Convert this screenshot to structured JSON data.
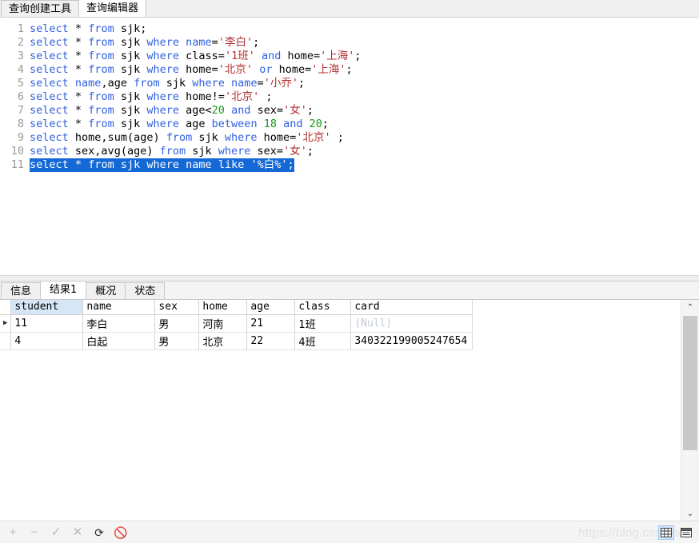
{
  "top_tabs": [
    {
      "label": "查询创建工具",
      "active": false
    },
    {
      "label": "查询编辑器",
      "active": true
    }
  ],
  "editor": {
    "line_numbers": [
      "1",
      "2",
      "3",
      "4",
      "5",
      "6",
      "7",
      "8",
      "9",
      "10",
      "11"
    ],
    "lines": [
      {
        "n": "1",
        "selected": false,
        "tokens": [
          {
            "t": "select",
            "c": "kw"
          },
          {
            "t": " ",
            "c": "plain"
          },
          {
            "t": "*",
            "c": "plain"
          },
          {
            "t": " ",
            "c": "plain"
          },
          {
            "t": "from",
            "c": "kw"
          },
          {
            "t": " ",
            "c": "plain"
          },
          {
            "t": "sjk;",
            "c": "plain"
          }
        ]
      },
      {
        "n": "2",
        "selected": false,
        "tokens": [
          {
            "t": "select",
            "c": "kw"
          },
          {
            "t": " ",
            "c": "plain"
          },
          {
            "t": "*",
            "c": "plain"
          },
          {
            "t": " ",
            "c": "plain"
          },
          {
            "t": "from",
            "c": "kw"
          },
          {
            "t": " ",
            "c": "plain"
          },
          {
            "t": "sjk ",
            "c": "plain"
          },
          {
            "t": "where",
            "c": "kw"
          },
          {
            "t": " ",
            "c": "plain"
          },
          {
            "t": "name",
            "c": "kw"
          },
          {
            "t": "=",
            "c": "plain"
          },
          {
            "t": "'李白'",
            "c": "str"
          },
          {
            "t": ";",
            "c": "plain"
          }
        ]
      },
      {
        "n": "3",
        "selected": false,
        "tokens": [
          {
            "t": "select",
            "c": "kw"
          },
          {
            "t": " ",
            "c": "plain"
          },
          {
            "t": "*",
            "c": "plain"
          },
          {
            "t": " ",
            "c": "plain"
          },
          {
            "t": "from",
            "c": "kw"
          },
          {
            "t": " ",
            "c": "plain"
          },
          {
            "t": "sjk ",
            "c": "plain"
          },
          {
            "t": "where",
            "c": "kw"
          },
          {
            "t": " ",
            "c": "plain"
          },
          {
            "t": "class=",
            "c": "plain"
          },
          {
            "t": "'1班'",
            "c": "str"
          },
          {
            "t": " ",
            "c": "plain"
          },
          {
            "t": "and",
            "c": "kw"
          },
          {
            "t": " ",
            "c": "plain"
          },
          {
            "t": "home=",
            "c": "plain"
          },
          {
            "t": "'上海'",
            "c": "str"
          },
          {
            "t": ";",
            "c": "plain"
          }
        ]
      },
      {
        "n": "4",
        "selected": false,
        "tokens": [
          {
            "t": "select",
            "c": "kw"
          },
          {
            "t": " ",
            "c": "plain"
          },
          {
            "t": "*",
            "c": "plain"
          },
          {
            "t": " ",
            "c": "plain"
          },
          {
            "t": "from",
            "c": "kw"
          },
          {
            "t": " ",
            "c": "plain"
          },
          {
            "t": "sjk ",
            "c": "plain"
          },
          {
            "t": "where",
            "c": "kw"
          },
          {
            "t": " ",
            "c": "plain"
          },
          {
            "t": "home=",
            "c": "plain"
          },
          {
            "t": "'北京'",
            "c": "str"
          },
          {
            "t": " ",
            "c": "plain"
          },
          {
            "t": "or",
            "c": "kw"
          },
          {
            "t": " ",
            "c": "plain"
          },
          {
            "t": "home=",
            "c": "plain"
          },
          {
            "t": "'上海'",
            "c": "str"
          },
          {
            "t": ";",
            "c": "plain"
          }
        ]
      },
      {
        "n": "5",
        "selected": false,
        "tokens": [
          {
            "t": "select",
            "c": "kw"
          },
          {
            "t": " ",
            "c": "plain"
          },
          {
            "t": "name",
            "c": "kw"
          },
          {
            "t": ",age ",
            "c": "plain"
          },
          {
            "t": "from",
            "c": "kw"
          },
          {
            "t": " ",
            "c": "plain"
          },
          {
            "t": "sjk ",
            "c": "plain"
          },
          {
            "t": "where",
            "c": "kw"
          },
          {
            "t": " ",
            "c": "plain"
          },
          {
            "t": "name",
            "c": "kw"
          },
          {
            "t": "=",
            "c": "plain"
          },
          {
            "t": "'小乔'",
            "c": "str"
          },
          {
            "t": ";",
            "c": "plain"
          }
        ]
      },
      {
        "n": "6",
        "selected": false,
        "tokens": [
          {
            "t": "select",
            "c": "kw"
          },
          {
            "t": " ",
            "c": "plain"
          },
          {
            "t": "*",
            "c": "plain"
          },
          {
            "t": " ",
            "c": "plain"
          },
          {
            "t": "from",
            "c": "kw"
          },
          {
            "t": " ",
            "c": "plain"
          },
          {
            "t": "sjk ",
            "c": "plain"
          },
          {
            "t": "where",
            "c": "kw"
          },
          {
            "t": " ",
            "c": "plain"
          },
          {
            "t": "home!=",
            "c": "plain"
          },
          {
            "t": "'北京'",
            "c": "str"
          },
          {
            "t": " ;",
            "c": "plain"
          }
        ]
      },
      {
        "n": "7",
        "selected": false,
        "tokens": [
          {
            "t": "select",
            "c": "kw"
          },
          {
            "t": " ",
            "c": "plain"
          },
          {
            "t": "*",
            "c": "plain"
          },
          {
            "t": " ",
            "c": "plain"
          },
          {
            "t": "from",
            "c": "kw"
          },
          {
            "t": " ",
            "c": "plain"
          },
          {
            "t": "sjk ",
            "c": "plain"
          },
          {
            "t": "where",
            "c": "kw"
          },
          {
            "t": " ",
            "c": "plain"
          },
          {
            "t": "age<",
            "c": "plain"
          },
          {
            "t": "20",
            "c": "num"
          },
          {
            "t": " ",
            "c": "plain"
          },
          {
            "t": "and",
            "c": "kw"
          },
          {
            "t": " ",
            "c": "plain"
          },
          {
            "t": "sex=",
            "c": "plain"
          },
          {
            "t": "'女'",
            "c": "str"
          },
          {
            "t": ";",
            "c": "plain"
          }
        ]
      },
      {
        "n": "8",
        "selected": false,
        "tokens": [
          {
            "t": "select",
            "c": "kw"
          },
          {
            "t": " ",
            "c": "plain"
          },
          {
            "t": "*",
            "c": "plain"
          },
          {
            "t": " ",
            "c": "plain"
          },
          {
            "t": "from",
            "c": "kw"
          },
          {
            "t": " ",
            "c": "plain"
          },
          {
            "t": "sjk ",
            "c": "plain"
          },
          {
            "t": "where",
            "c": "kw"
          },
          {
            "t": " ",
            "c": "plain"
          },
          {
            "t": "age ",
            "c": "plain"
          },
          {
            "t": "between",
            "c": "kw"
          },
          {
            "t": " ",
            "c": "plain"
          },
          {
            "t": "18",
            "c": "num"
          },
          {
            "t": " ",
            "c": "plain"
          },
          {
            "t": "and",
            "c": "kw"
          },
          {
            "t": " ",
            "c": "plain"
          },
          {
            "t": "20",
            "c": "num"
          },
          {
            "t": ";",
            "c": "plain"
          }
        ]
      },
      {
        "n": "9",
        "selected": false,
        "tokens": [
          {
            "t": "select",
            "c": "kw"
          },
          {
            "t": " ",
            "c": "plain"
          },
          {
            "t": "home,sum(age) ",
            "c": "plain"
          },
          {
            "t": "from",
            "c": "kw"
          },
          {
            "t": " ",
            "c": "plain"
          },
          {
            "t": "sjk ",
            "c": "plain"
          },
          {
            "t": "where",
            "c": "kw"
          },
          {
            "t": " ",
            "c": "plain"
          },
          {
            "t": "home=",
            "c": "plain"
          },
          {
            "t": "'北京'",
            "c": "str"
          },
          {
            "t": " ;",
            "c": "plain"
          }
        ]
      },
      {
        "n": "10",
        "selected": false,
        "tokens": [
          {
            "t": "select",
            "c": "kw"
          },
          {
            "t": " ",
            "c": "plain"
          },
          {
            "t": "sex,avg(age) ",
            "c": "plain"
          },
          {
            "t": "from",
            "c": "kw"
          },
          {
            "t": " ",
            "c": "plain"
          },
          {
            "t": "sjk ",
            "c": "plain"
          },
          {
            "t": "where",
            "c": "kw"
          },
          {
            "t": " ",
            "c": "plain"
          },
          {
            "t": "sex=",
            "c": "plain"
          },
          {
            "t": "'女'",
            "c": "str"
          },
          {
            "t": ";",
            "c": "plain"
          }
        ]
      },
      {
        "n": "11",
        "selected": true,
        "tokens": [
          {
            "t": "select",
            "c": "kw"
          },
          {
            "t": " ",
            "c": "plain"
          },
          {
            "t": "*",
            "c": "plain"
          },
          {
            "t": " ",
            "c": "plain"
          },
          {
            "t": "from",
            "c": "kw"
          },
          {
            "t": " ",
            "c": "plain"
          },
          {
            "t": "sjk ",
            "c": "plain"
          },
          {
            "t": "where",
            "c": "kw"
          },
          {
            "t": " ",
            "c": "plain"
          },
          {
            "t": "name",
            "c": "kw"
          },
          {
            "t": " ",
            "c": "plain"
          },
          {
            "t": "like",
            "c": "kw"
          },
          {
            "t": " ",
            "c": "plain"
          },
          {
            "t": "'%白%'",
            "c": "str"
          },
          {
            "t": ";",
            "c": "plain"
          }
        ]
      }
    ]
  },
  "result_tabs": [
    {
      "label": "信息",
      "active": false
    },
    {
      "label": "结果1",
      "active": true
    },
    {
      "label": "概况",
      "active": false
    },
    {
      "label": "状态",
      "active": false
    }
  ],
  "grid": {
    "columns": [
      "student",
      "name",
      "sex",
      "home",
      "age",
      "class",
      "card"
    ],
    "selected_column": "student",
    "rows": [
      {
        "marker": "▶",
        "current": true,
        "cells": [
          "11",
          "李白",
          "男",
          "河南",
          "21",
          "1班",
          "(Null)"
        ]
      },
      {
        "marker": "",
        "current": false,
        "cells": [
          "4",
          "白起",
          "男",
          "北京",
          "22",
          "4班",
          "340322199005247654"
        ]
      }
    ]
  },
  "scrollbar": {
    "up_arrow": "⌃",
    "down_arrow": "⌄"
  },
  "bottombar": {
    "icons": [
      {
        "name": "add-record-icon",
        "glyph": "+",
        "dark": false
      },
      {
        "name": "delete-record-icon",
        "glyph": "−",
        "dark": false
      },
      {
        "name": "confirm-icon",
        "glyph": "✓",
        "dark": false
      },
      {
        "name": "cancel-icon",
        "glyph": "✕",
        "dark": false
      },
      {
        "name": "refresh-icon",
        "glyph": "⟳",
        "dark": true
      },
      {
        "name": "stop-icon",
        "glyph": "🚫",
        "dark": true
      }
    ],
    "watermark": "https://blog.csdn.net/",
    "view_modes": [
      {
        "name": "grid-view-icon",
        "active": true
      },
      {
        "name": "form-view-icon",
        "active": false
      }
    ]
  },
  "colors": {
    "keyword": "#2f5fe0",
    "string": "#b03030",
    "number": "#1a9a1a",
    "selection": "#1569d6",
    "selected_column_header": "#d5e6f7",
    "accent_blue": "#d6e8fb"
  }
}
